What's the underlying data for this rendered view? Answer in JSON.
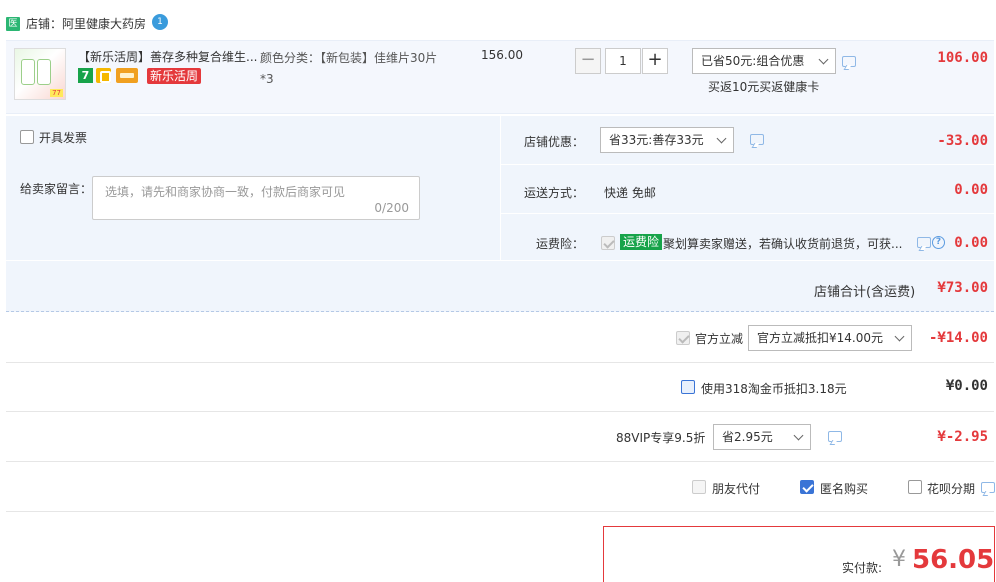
{
  "shop": {
    "logo_text": "医",
    "name": "店铺：阿里健康大药房",
    "badge": "1"
  },
  "item": {
    "title": "【新乐活周】善存多种复合维生...",
    "icon_7": "7",
    "promo_tag": "新乐活周",
    "thumb_tag": "77",
    "attr_label": "颜色分类：【新包装】佳维片30片*3",
    "price": "156.00",
    "quantity": "1",
    "qty_minus": "−",
    "qty_plus": "+",
    "discount_select": "已省50元:组合优惠",
    "gift_text": "买返10元买返健康卡",
    "subtotal": "106.00"
  },
  "invoice": {
    "label": "开具发票"
  },
  "message": {
    "label": "给卖家留言：",
    "placeholder": "选填，请先和商家协商一致，付款后商家可见",
    "counter": "0/200"
  },
  "shop_discount": {
    "label": "店铺优惠：",
    "select": "省33元:善存33元",
    "amount": "-33.00"
  },
  "shipping": {
    "label": "运送方式：",
    "value": "快递 免邮",
    "amount": "0.00"
  },
  "insurance": {
    "label": "运费险：",
    "tag": "运费险",
    "text": "聚划算卖家赠送，若确认收货前退货，可获...",
    "q_icon": "?",
    "amount": "0.00"
  },
  "shop_total": {
    "label": "店铺合计(含运费)",
    "amount": "¥73.00"
  },
  "official_discount": {
    "label": "官方立减",
    "select": "官方立减抵扣¥14.00元",
    "amount": "-¥14.00"
  },
  "taojinbi": {
    "label": "使用318淘金币抵扣3.18元",
    "amount": "¥0.00"
  },
  "vip": {
    "label": "88VIP专享9.5折",
    "select": "省2.95元",
    "amount": "¥-2.95"
  },
  "options": {
    "friend_pay": "朋友代付",
    "anonymous": "匿名购买",
    "huabei": "花呗分期"
  },
  "pay": {
    "label": "实付款:",
    "currency": "¥",
    "amount": "56.05"
  }
}
